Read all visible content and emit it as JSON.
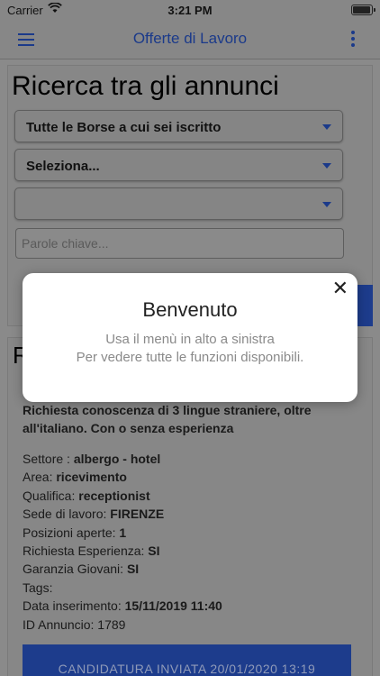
{
  "status_bar": {
    "carrier": "Carrier",
    "time": "3:21 PM"
  },
  "nav": {
    "title": "Offerte di Lavoro"
  },
  "search": {
    "title": "Ricerca tra gli annunci",
    "select_1": "Tutte le Borse a cui sei iscritto",
    "select_2": "Seleziona...",
    "select_3": "",
    "keywords_placeholder": "Parole chiave..."
  },
  "result": {
    "heading_partial": "R",
    "description": "Richiesta conoscenza di 3 lingue straniere, oltre all'italiano. Con o senza esperienza",
    "fields": [
      {
        "label": "Settore : ",
        "value": "albergo - hotel"
      },
      {
        "label": "Area: ",
        "value": "ricevimento"
      },
      {
        "label": "Qualifica: ",
        "value": "receptionist"
      },
      {
        "label": "Sede di lavoro: ",
        "value": "FIRENZE"
      },
      {
        "label": "Posizioni aperte: ",
        "value": "1"
      },
      {
        "label": "Richiesta Esperienza: ",
        "value": "SI"
      },
      {
        "label": "Garanzia Giovani: ",
        "value": "SI"
      },
      {
        "label": "Tags: ",
        "value": ""
      },
      {
        "label": "Data inserimento: ",
        "value": "15/11/2019 11:40"
      },
      {
        "label": "ID Annuncio: ",
        "value": "1789"
      }
    ],
    "apply_label": "CANDIDATURA INVIATA 20/01/2020 13:19"
  },
  "modal": {
    "title": "Benvenuto",
    "line_1": "Usa il menù in alto a sinistra",
    "line_2": "Per vedere tutte le funzioni disponibili.",
    "close_glyph": "✕"
  }
}
